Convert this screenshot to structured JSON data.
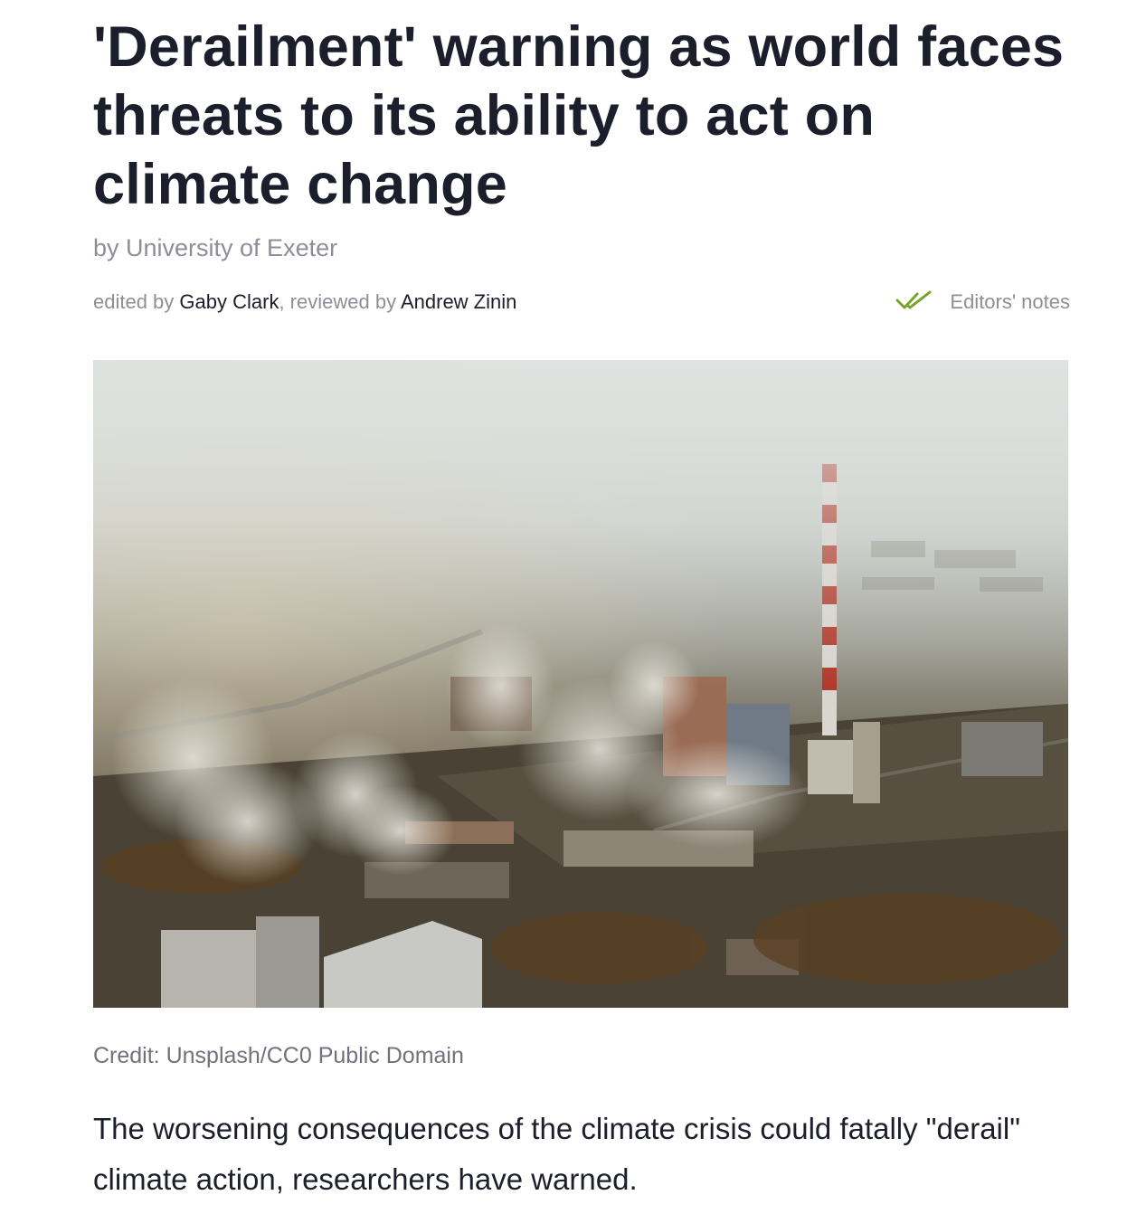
{
  "article": {
    "headline": "'Derailment' warning as world faces threats to its ability to act on climate change",
    "byline": "by University of Exeter",
    "edited_prefix": "edited by ",
    "editor": "Gaby Clark",
    "reviewed_prefix": ", reviewed by ",
    "reviewer": "Andrew Zinin",
    "editors_notes_label": "Editors' notes",
    "image_credit": "Credit: Unsplash/CC0 Public Domain",
    "lede": "The worsening consequences of the climate crisis could fatally \"derail\" climate action, researchers have warned."
  },
  "icons": {
    "editors_notes": "double-check-icon"
  },
  "colors": {
    "accent_check": "#7aa32a",
    "headline_text": "#1c1f2b",
    "muted_text": "#8d8f98"
  }
}
